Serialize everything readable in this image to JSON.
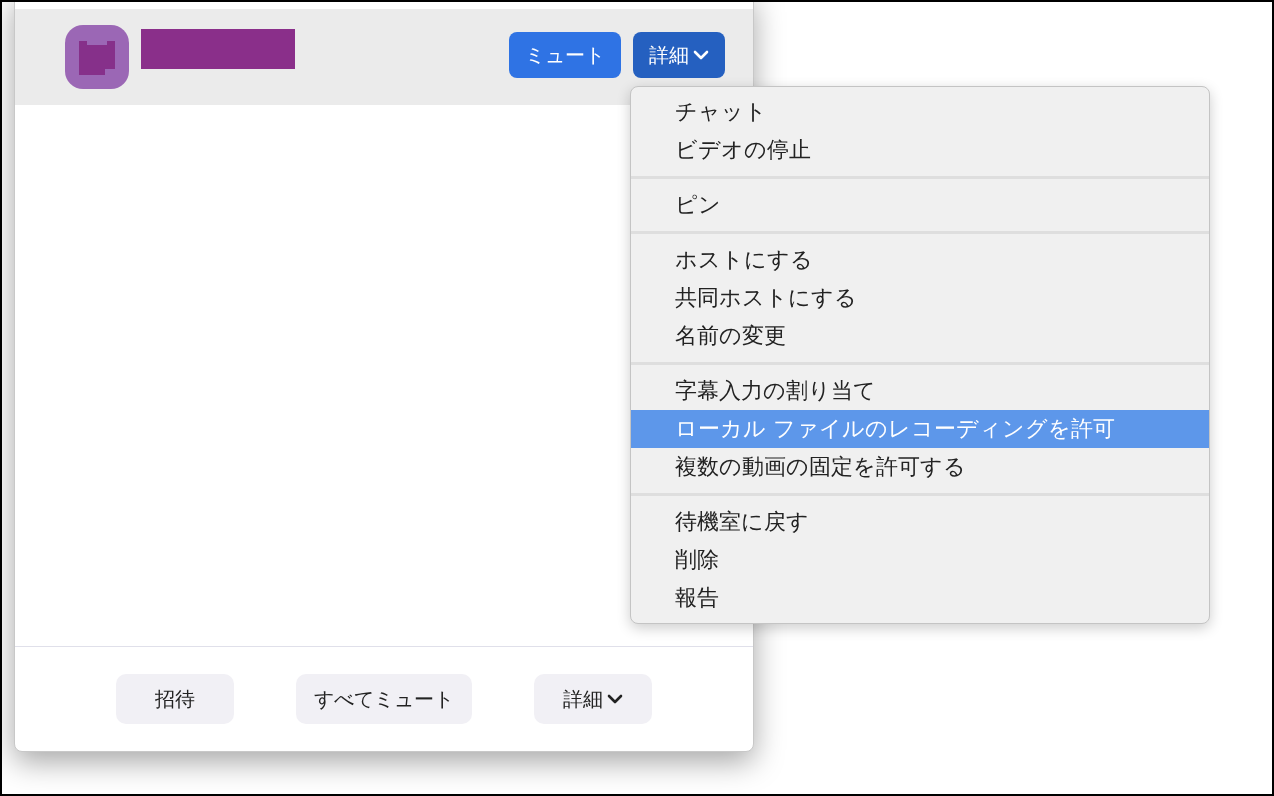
{
  "participant": {
    "mute_button": "ミュート",
    "more_button": "詳細"
  },
  "menu": {
    "sections": [
      [
        {
          "label": "チャット",
          "selected": false
        },
        {
          "label": "ビデオの停止",
          "selected": false
        }
      ],
      [
        {
          "label": "ピン",
          "selected": false
        }
      ],
      [
        {
          "label": "ホストにする",
          "selected": false
        },
        {
          "label": "共同ホストにする",
          "selected": false
        },
        {
          "label": "名前の変更",
          "selected": false
        }
      ],
      [
        {
          "label": "字幕入力の割り当て",
          "selected": false
        },
        {
          "label": "ローカル ファイルのレコーディングを許可",
          "selected": true
        },
        {
          "label": "複数の動画の固定を許可する",
          "selected": false
        }
      ],
      [
        {
          "label": "待機室に戻す",
          "selected": false
        },
        {
          "label": "削除",
          "selected": false
        },
        {
          "label": "報告",
          "selected": false
        }
      ]
    ]
  },
  "footer_buttons": [
    {
      "label": "招待",
      "kind": "plain"
    },
    {
      "label": "すべてミュート",
      "kind": "plain"
    },
    {
      "label": "詳細",
      "kind": "dropdown"
    }
  ]
}
